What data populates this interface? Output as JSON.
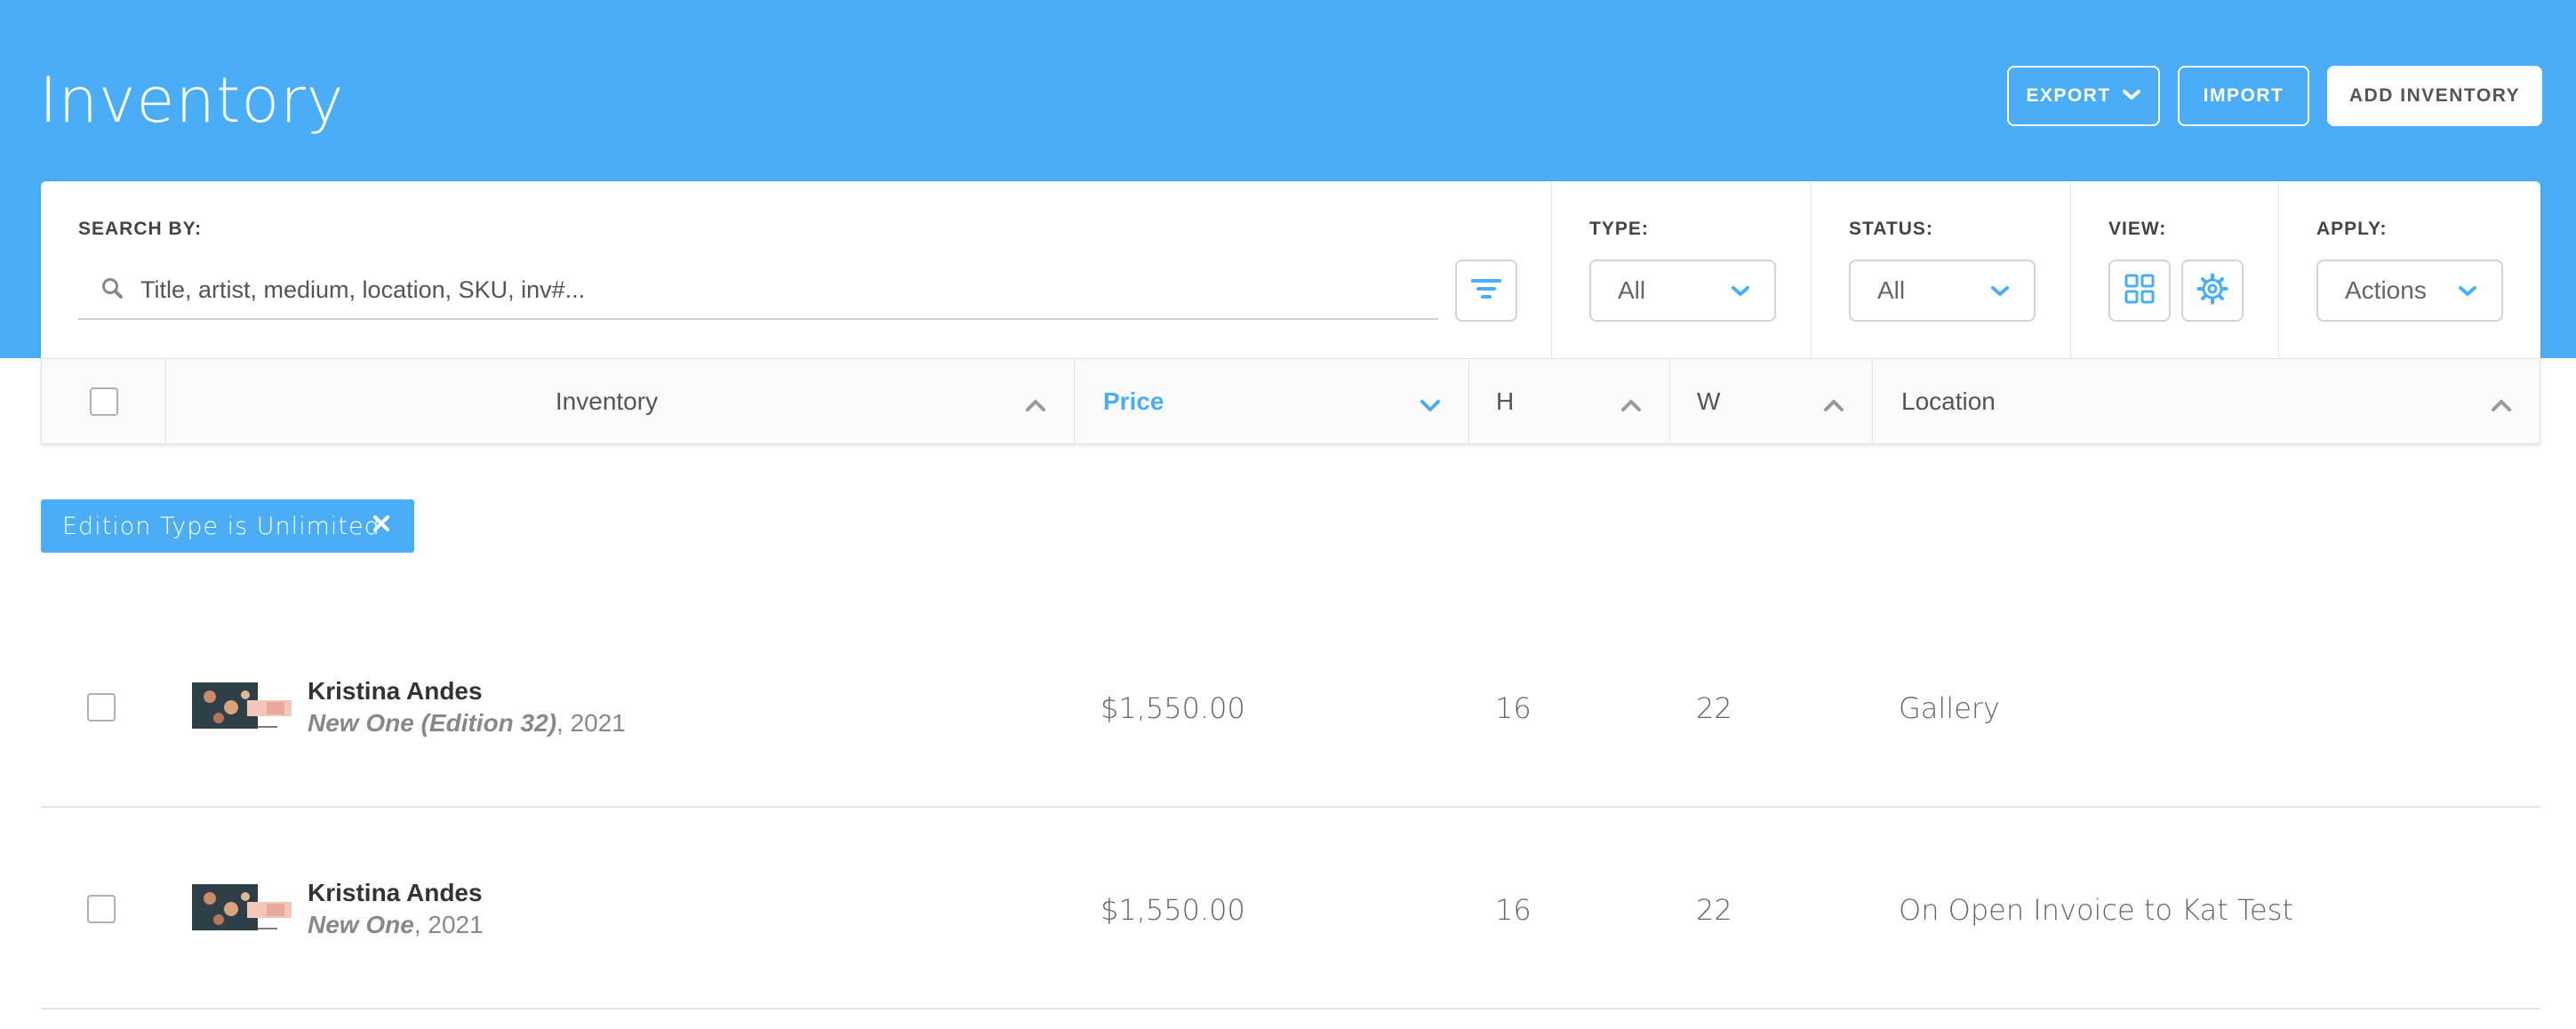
{
  "header": {
    "title": "Inventory",
    "export_label": "EXPORT",
    "import_label": "IMPORT",
    "add_label": "ADD INVENTORY"
  },
  "filters": {
    "search_label": "SEARCH BY:",
    "search_placeholder": "Title, artist, medium, location, SKU, inv#...",
    "type_label": "TYPE:",
    "type_value": "All",
    "status_label": "STATUS:",
    "status_value": "All",
    "view_label": "VIEW:",
    "apply_label": "APPLY:",
    "apply_value": "Actions"
  },
  "columns": {
    "inventory": "Inventory",
    "price": "Price",
    "h": "H",
    "w": "W",
    "location": "Location"
  },
  "active_filter": {
    "label": "Edition Type is Unlimited"
  },
  "rows": [
    {
      "artist": "Kristina Andes",
      "title": "New One (Edition 32)",
      "year": ", 2021",
      "price": "$1,550.00",
      "h": "16",
      "w": "22",
      "location": "Gallery"
    },
    {
      "artist": "Kristina Andes",
      "title": "New One",
      "year": ", 2021",
      "price": "$1,550.00",
      "h": "16",
      "w": "22",
      "location": "On Open Invoice to Kat Test"
    }
  ],
  "colors": {
    "brand_blue": "#4badf6",
    "border": "#d3d3d3"
  },
  "icons": [
    "chevron-down-icon",
    "search-icon",
    "filter-icon",
    "grid-view-icon",
    "gear-icon",
    "chevron-up-icon",
    "close-icon"
  ]
}
